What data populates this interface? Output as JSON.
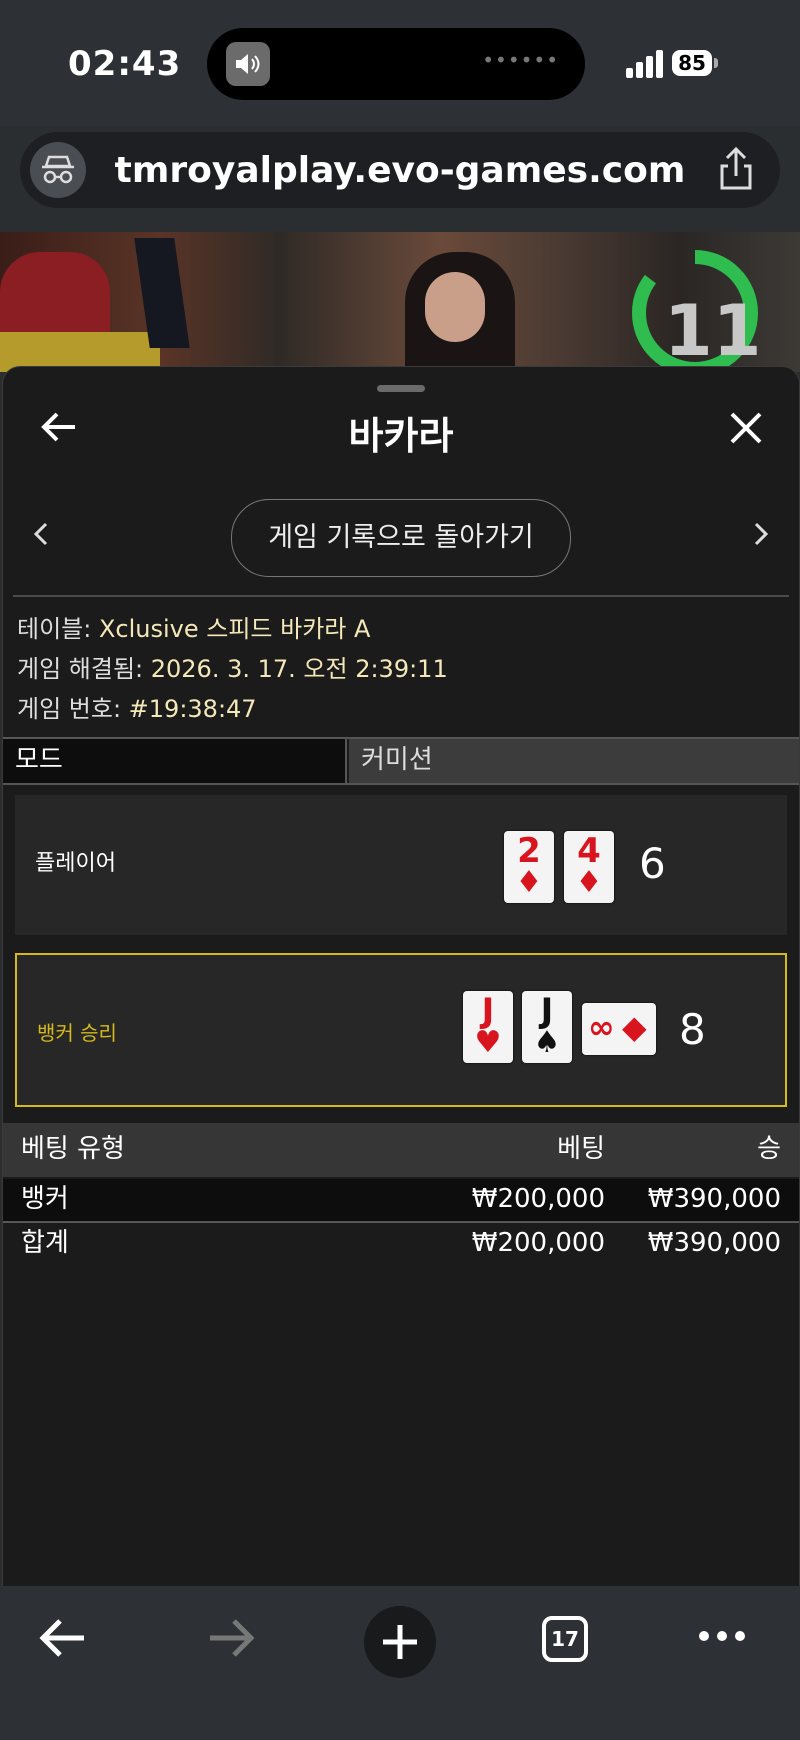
{
  "status_bar": {
    "time": "02:43",
    "battery": "85"
  },
  "browser": {
    "url": "tmroyalplay.evo-games.com",
    "tab_count": "17"
  },
  "video": {
    "timer": "11"
  },
  "panel": {
    "title": "바카라",
    "back_to_history": "게임 기록으로 돌아가기",
    "info": {
      "table_label": "테이블: ",
      "table_value": "Xclusive 스피드 바카라 A",
      "resolved_label": "게임 해결됨: ",
      "resolved_value": "2026. 3. 17. 오전 2:39:11",
      "game_no_label": "게임 번호: ",
      "game_no_value": "#19:38:47"
    },
    "mode_label": "모드",
    "mode_value": "커미션",
    "player": {
      "label": "플레이어",
      "score": "6",
      "cards": [
        {
          "rank": "2",
          "suit": "♦",
          "color": "red"
        },
        {
          "rank": "4",
          "suit": "♦",
          "color": "red"
        }
      ]
    },
    "banker": {
      "label": "뱅커 승리",
      "score": "8",
      "cards": [
        {
          "rank": "J",
          "suit": "♥",
          "color": "red"
        },
        {
          "rank": "J",
          "suit": "♠",
          "color": "black"
        },
        {
          "rank": "∞",
          "suit": "◆",
          "color": "red",
          "sideways": true
        }
      ]
    },
    "bets": {
      "headers": [
        "베팅 유형",
        "베팅",
        "승"
      ],
      "rows": [
        {
          "type": "뱅커",
          "bet": "₩200,000",
          "win": "₩390,000"
        }
      ],
      "total": {
        "type": "합계",
        "bet": "₩200,000",
        "win": "₩390,000"
      }
    }
  },
  "colors": {
    "accent_gold": "#d6b91c",
    "card_red": "#d8141e",
    "timer_green": "#2ebd4e"
  }
}
